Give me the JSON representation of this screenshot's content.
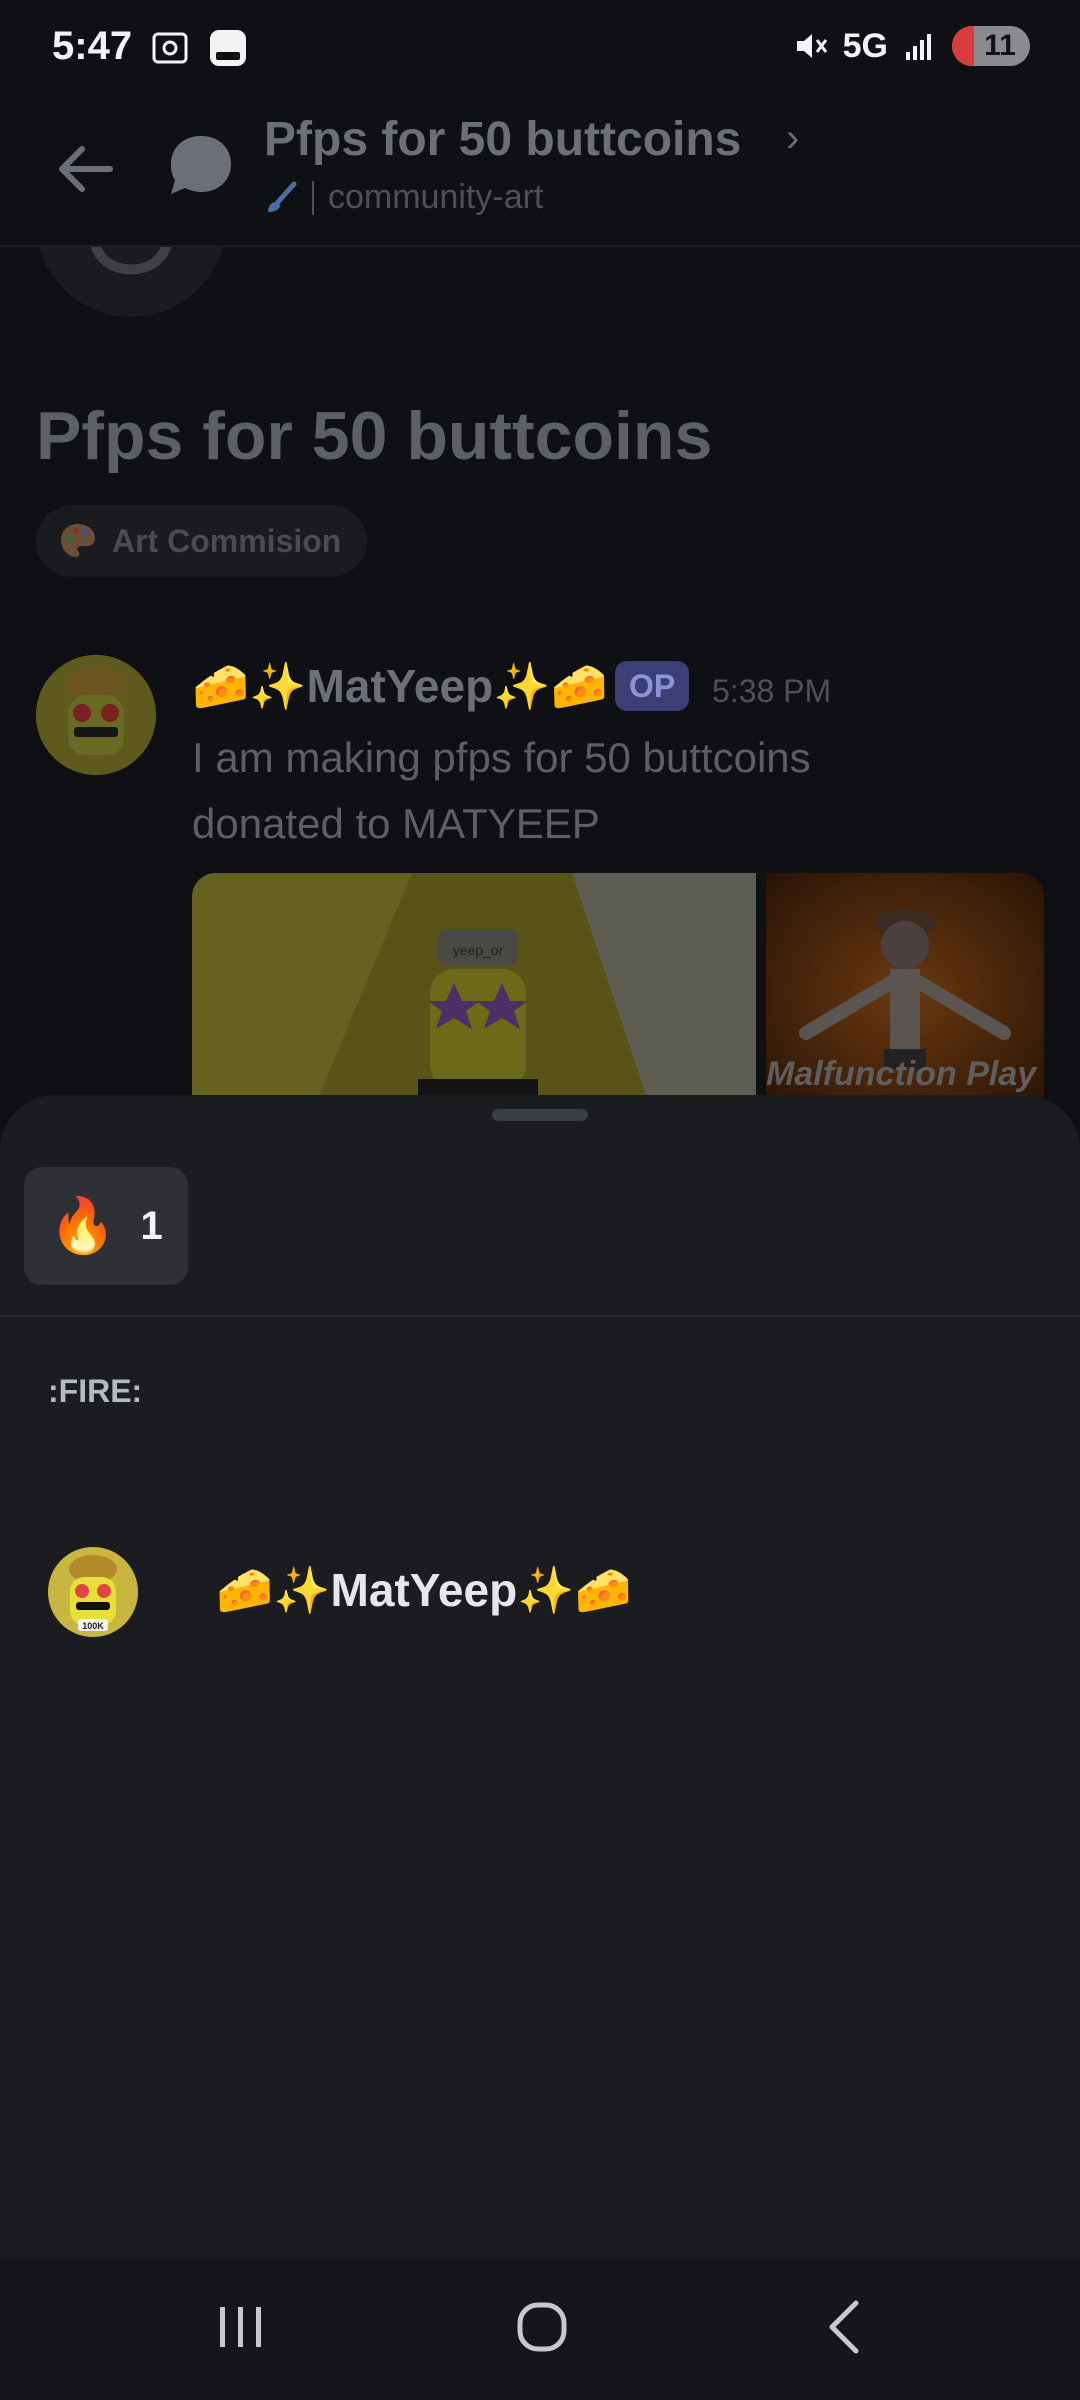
{
  "status_bar": {
    "time": "5:47",
    "network": "5G",
    "battery": "11"
  },
  "top_bar": {
    "title": "Pfps for 50 buttcoins",
    "channel": "community-art"
  },
  "post": {
    "title": "Pfps for 50 buttcoins",
    "tag": "Art Commision",
    "message": {
      "author": "🧀✨MatYeep✨🧀",
      "badge": "OP",
      "time": "5:38 PM",
      "text": "I am making pfps for 50 buttcoins donated to MATYEEP",
      "image_captions": {
        "image1": "yeep_or",
        "image2": "Malfunction Play"
      }
    }
  },
  "reactions_sheet": {
    "reaction": {
      "emoji": "🔥",
      "count": "1"
    },
    "emoji_name": ":FIRE:",
    "users": [
      {
        "name": "🧀✨MatYeep✨🧀",
        "avatar_badge": "100K"
      }
    ]
  },
  "icons": {
    "back": "arrow-left-icon",
    "thread": "thread-bubble-icon",
    "chevron": "chevron-right-icon",
    "brush": "paintbrush-icon",
    "palette": "palette-icon"
  },
  "colors": {
    "accent_op": "#3b3f75",
    "sheet_bg": "#1b1c20",
    "app_bg": "#0f1013"
  }
}
